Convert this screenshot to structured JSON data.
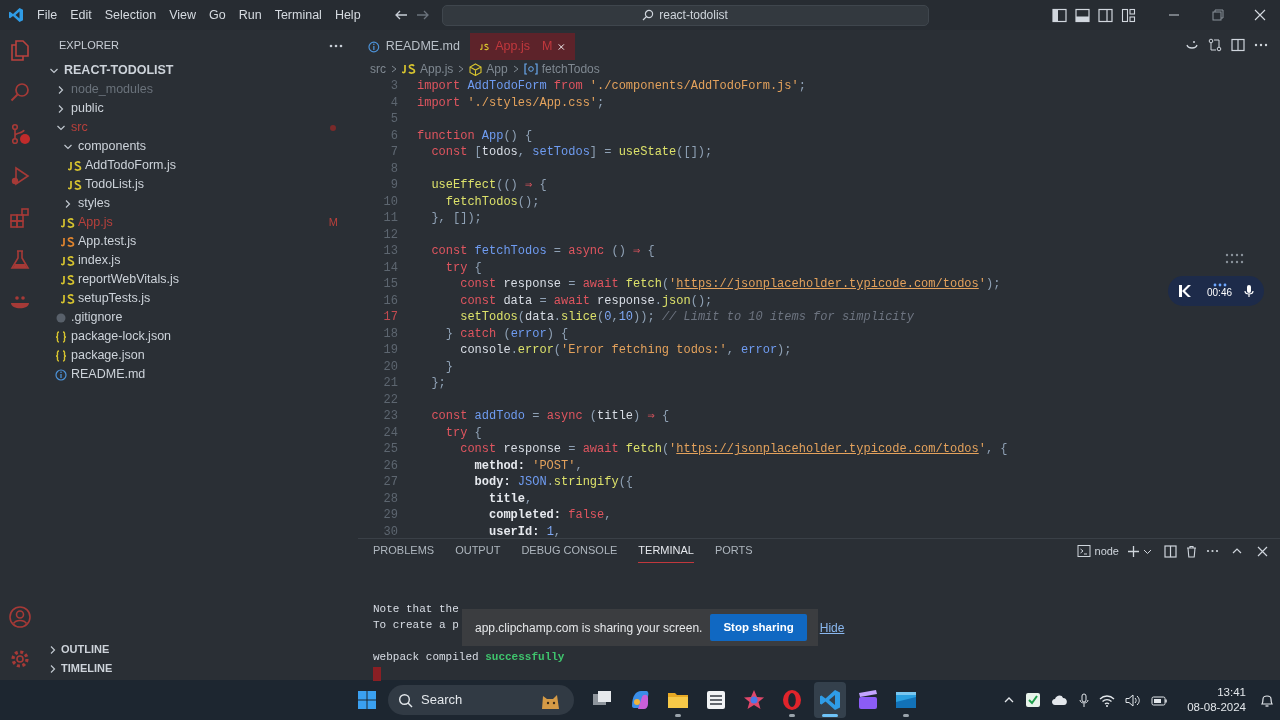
{
  "title_bar": {
    "menu": [
      "File",
      "Edit",
      "Selection",
      "View",
      "Go",
      "Run",
      "Terminal",
      "Help"
    ],
    "search": "react-todolist"
  },
  "sidebar": {
    "title": "EXPLORER",
    "tree": {
      "label": "REACT-TODOLIST",
      "kind": "root",
      "expanded": true,
      "modified": false,
      "ignored": false,
      "children": [
        {
          "label": "node_modules",
          "kind": "folder",
          "expanded": false,
          "modified": false,
          "ignored": true
        },
        {
          "label": "public",
          "kind": "folder",
          "expanded": false,
          "modified": false,
          "ignored": false
        },
        {
          "label": "src",
          "kind": "folder",
          "expanded": true,
          "modified": true,
          "ignored": false,
          "children": [
            {
              "label": "components",
              "kind": "folder",
              "expanded": true,
              "modified": false,
              "ignored": false,
              "children": [
                {
                  "label": "AddTodoForm.js",
                  "kind": "js",
                  "modified": false,
                  "ignored": false
                },
                {
                  "label": "TodoList.js",
                  "kind": "js",
                  "modified": false,
                  "ignored": false
                }
              ]
            },
            {
              "label": "styles",
              "kind": "folder",
              "expanded": false,
              "modified": false,
              "ignored": false
            },
            {
              "label": "App.js",
              "kind": "js",
              "modified": true,
              "ignored": false,
              "badge": "M"
            },
            {
              "label": "App.test.js",
              "kind": "test",
              "modified": false,
              "ignored": false
            },
            {
              "label": "index.js",
              "kind": "js",
              "modified": false,
              "ignored": false
            },
            {
              "label": "reportWebVitals.js",
              "kind": "js",
              "modified": false,
              "ignored": false
            },
            {
              "label": "setupTests.js",
              "kind": "js",
              "modified": false,
              "ignored": false
            }
          ]
        },
        {
          "label": ".gitignore",
          "kind": "config",
          "modified": false,
          "ignored": false
        },
        {
          "label": "package-lock.json",
          "kind": "json",
          "modified": false,
          "ignored": false
        },
        {
          "label": "package.json",
          "kind": "json",
          "modified": false,
          "ignored": false
        },
        {
          "label": "README.md",
          "kind": "info",
          "modified": false,
          "ignored": false
        }
      ]
    },
    "sections": [
      {
        "label": "OUTLINE",
        "expanded": false
      },
      {
        "label": "TIMELINE",
        "expanded": false
      }
    ]
  },
  "tabs": [
    {
      "label": "README.md",
      "kind": "info",
      "selected": false
    },
    {
      "label": "App.js",
      "kind": "js",
      "selected": true,
      "badge": "M"
    }
  ],
  "breadcrumbs": [
    {
      "label": "src",
      "kind": "folder"
    },
    {
      "label": "App.js",
      "kind": "js"
    },
    {
      "label": "App",
      "kind": "component"
    },
    {
      "label": "fetchTodos",
      "kind": "variable"
    }
  ],
  "editor": {
    "lines": [
      {
        "number": "3",
        "current": false,
        "tokens": [
          {
            "text": "import ",
            "kind": "kw"
          },
          {
            "text": "AddTodoForm",
            "kind": "id"
          },
          {
            "text": " from ",
            "kind": "kw"
          },
          {
            "text": "'./components/AddTodoForm.js'",
            "kind": "str"
          },
          {
            "text": ";",
            "kind": "p"
          }
        ]
      },
      {
        "number": "4",
        "current": false,
        "tokens": [
          {
            "text": "import ",
            "kind": "kw"
          },
          {
            "text": "'./styles/App.css'",
            "kind": "str"
          },
          {
            "text": ";",
            "kind": "p"
          }
        ]
      },
      {
        "number": "5",
        "current": false
      },
      {
        "number": "6",
        "current": false,
        "tokens": [
          {
            "text": "function ",
            "kind": "kw"
          },
          {
            "text": "App",
            "kind": "id"
          },
          {
            "text": "() {",
            "kind": "p"
          }
        ]
      },
      {
        "number": "7",
        "current": false,
        "tokens": [
          {
            "text": "  const ",
            "kind": "kw"
          },
          {
            "text": "[",
            "kind": "p"
          },
          {
            "text": "todos",
            "kind": "pl"
          },
          {
            "text": ", ",
            "kind": "p"
          },
          {
            "text": "setTodos",
            "kind": "id"
          },
          {
            "text": "] = ",
            "kind": "p"
          },
          {
            "text": "useState",
            "kind": "fn"
          },
          {
            "text": "([]);",
            "kind": "p"
          }
        ]
      },
      {
        "number": "8",
        "current": false
      },
      {
        "number": "9",
        "current": false,
        "tokens": [
          {
            "text": "  useEffect",
            "kind": "fn"
          },
          {
            "text": "(() ",
            "kind": "p"
          },
          {
            "text": "⇒",
            "kind": "kw"
          },
          {
            "text": " {",
            "kind": "p"
          }
        ]
      },
      {
        "number": "10",
        "current": false,
        "tokens": [
          {
            "text": "    fetchTodos",
            "kind": "fn"
          },
          {
            "text": "();",
            "kind": "p"
          }
        ]
      },
      {
        "number": "11",
        "current": false,
        "tokens": [
          {
            "text": "  }, []);",
            "kind": "p"
          }
        ]
      },
      {
        "number": "12",
        "current": false
      },
      {
        "number": "13",
        "current": false,
        "tokens": [
          {
            "text": "  const ",
            "kind": "kw"
          },
          {
            "text": "fetchTodos",
            "kind": "id"
          },
          {
            "text": " = ",
            "kind": "p"
          },
          {
            "text": "async ",
            "kind": "kw"
          },
          {
            "text": "() ",
            "kind": "p"
          },
          {
            "text": "⇒",
            "kind": "kw"
          },
          {
            "text": " {",
            "kind": "p"
          }
        ]
      },
      {
        "number": "14",
        "current": false,
        "tokens": [
          {
            "text": "    try ",
            "kind": "kw"
          },
          {
            "text": "{",
            "kind": "p"
          }
        ]
      },
      {
        "number": "15",
        "current": false,
        "tokens": [
          {
            "text": "      const ",
            "kind": "kw"
          },
          {
            "text": "response",
            "kind": "pl"
          },
          {
            "text": " = ",
            "kind": "p"
          },
          {
            "text": "await ",
            "kind": "kw"
          },
          {
            "text": "fetch",
            "kind": "fn"
          },
          {
            "text": "(",
            "kind": "p"
          },
          {
            "text": "'",
            "kind": "str"
          },
          {
            "text": "https://jsonplaceholder.typicode.com/todos",
            "kind": "url"
          },
          {
            "text": "'",
            "kind": "str"
          },
          {
            "text": ");",
            "kind": "p"
          }
        ]
      },
      {
        "number": "16",
        "current": false,
        "tokens": [
          {
            "text": "      const ",
            "kind": "kw"
          },
          {
            "text": "data",
            "kind": "pl"
          },
          {
            "text": " = ",
            "kind": "p"
          },
          {
            "text": "await ",
            "kind": "kw"
          },
          {
            "text": "response",
            "kind": "pl"
          },
          {
            "text": ".",
            "kind": "p"
          },
          {
            "text": "json",
            "kind": "fn"
          },
          {
            "text": "();",
            "kind": "p"
          }
        ]
      },
      {
        "number": "17",
        "current": true,
        "tokens": [
          {
            "text": "      setTodos",
            "kind": "fn"
          },
          {
            "text": "(",
            "kind": "p"
          },
          {
            "text": "data",
            "kind": "pl"
          },
          {
            "text": ".",
            "kind": "p"
          },
          {
            "text": "slice",
            "kind": "fn"
          },
          {
            "text": "(",
            "kind": "p"
          },
          {
            "text": "0",
            "kind": "num"
          },
          {
            "text": ",",
            "kind": "p"
          },
          {
            "text": "10",
            "kind": "num"
          },
          {
            "text": ")); ",
            "kind": "p"
          },
          {
            "text": "// Limit to 10 items for simplicity",
            "kind": "cm"
          }
        ]
      },
      {
        "number": "18",
        "current": false,
        "tokens": [
          {
            "text": "    } ",
            "kind": "p"
          },
          {
            "text": "catch ",
            "kind": "kw"
          },
          {
            "text": "(",
            "kind": "p"
          },
          {
            "text": "error",
            "kind": "id"
          },
          {
            "text": ") {",
            "kind": "p"
          }
        ]
      },
      {
        "number": "19",
        "current": false,
        "tokens": [
          {
            "text": "      console",
            "kind": "pl"
          },
          {
            "text": ".",
            "kind": "p"
          },
          {
            "text": "error",
            "kind": "fn"
          },
          {
            "text": "(",
            "kind": "p"
          },
          {
            "text": "'Error fetching todos:'",
            "kind": "str"
          },
          {
            "text": ", ",
            "kind": "p"
          },
          {
            "text": "error",
            "kind": "id"
          },
          {
            "text": ");",
            "kind": "p"
          }
        ]
      },
      {
        "number": "20",
        "current": false,
        "tokens": [
          {
            "text": "    }",
            "kind": "p"
          }
        ]
      },
      {
        "number": "21",
        "current": false,
        "tokens": [
          {
            "text": "  };",
            "kind": "p"
          }
        ]
      },
      {
        "number": "22",
        "current": false
      },
      {
        "number": "23",
        "current": false,
        "tokens": [
          {
            "text": "  const ",
            "kind": "kw"
          },
          {
            "text": "addTodo",
            "kind": "id"
          },
          {
            "text": " = ",
            "kind": "p"
          },
          {
            "text": "async ",
            "kind": "kw"
          },
          {
            "text": "(",
            "kind": "p"
          },
          {
            "text": "title",
            "kind": "pl"
          },
          {
            "text": ") ",
            "kind": "p"
          },
          {
            "text": "⇒",
            "kind": "kw"
          },
          {
            "text": " {",
            "kind": "p"
          }
        ]
      },
      {
        "number": "24",
        "current": false,
        "tokens": [
          {
            "text": "    try ",
            "kind": "kw"
          },
          {
            "text": "{",
            "kind": "p"
          }
        ]
      },
      {
        "number": "25",
        "current": false,
        "tokens": [
          {
            "text": "      const ",
            "kind": "kw"
          },
          {
            "text": "response",
            "kind": "pl"
          },
          {
            "text": " = ",
            "kind": "p"
          },
          {
            "text": "await ",
            "kind": "kw"
          },
          {
            "text": "fetch",
            "kind": "fn"
          },
          {
            "text": "(",
            "kind": "p"
          },
          {
            "text": "'",
            "kind": "str"
          },
          {
            "text": "https://jsonplaceholder.typicode.com/todos",
            "kind": "url"
          },
          {
            "text": "'",
            "kind": "str"
          },
          {
            "text": ", {",
            "kind": "p"
          }
        ]
      },
      {
        "number": "26",
        "current": false,
        "tokens": [
          {
            "text": "        method: ",
            "kind": "prop"
          },
          {
            "text": "'POST'",
            "kind": "str"
          },
          {
            "text": ",",
            "kind": "p"
          }
        ]
      },
      {
        "number": "27",
        "current": false,
        "tokens": [
          {
            "text": "        body: ",
            "kind": "prop"
          },
          {
            "text": "JSON",
            "kind": "id"
          },
          {
            "text": ".",
            "kind": "p"
          },
          {
            "text": "stringify",
            "kind": "fn"
          },
          {
            "text": "({",
            "kind": "p"
          }
        ]
      },
      {
        "number": "28",
        "current": false,
        "tokens": [
          {
            "text": "          title",
            "kind": "prop"
          },
          {
            "text": ",",
            "kind": "p"
          }
        ]
      },
      {
        "number": "29",
        "current": false,
        "tokens": [
          {
            "text": "          completed: ",
            "kind": "prop"
          },
          {
            "text": "false",
            "kind": "kw"
          },
          {
            "text": ",",
            "kind": "p"
          }
        ]
      },
      {
        "number": "30",
        "current": false,
        "tokens": [
          {
            "text": "          userId: ",
            "kind": "prop"
          },
          {
            "text": "1",
            "kind": "num"
          },
          {
            "text": ",",
            "kind": "p"
          }
        ]
      }
    ]
  },
  "recording_widget": {
    "time": "00:46"
  },
  "panel": {
    "tabs": [
      {
        "label": "PROBLEMS",
        "selected": false
      },
      {
        "label": "OUTPUT",
        "selected": false
      },
      {
        "label": "DEBUG CONSOLE",
        "selected": false
      },
      {
        "label": "TERMINAL",
        "selected": true
      },
      {
        "label": "PORTS",
        "selected": false
      }
    ],
    "terminal_name": "node",
    "terminal_lines": [
      {
        "tokens": [
          {
            "text": "Note that the",
            "kind": "pl"
          }
        ]
      },
      {
        "tokens": [
          {
            "text": "To create a p",
            "kind": "pl"
          }
        ]
      }
    ],
    "compile_message": {
      "tokens": [
        {
          "text": "webpack compiled ",
          "kind": "pl"
        },
        {
          "text": "successfully",
          "kind": "success"
        }
      ]
    }
  },
  "share_bar": {
    "message": "app.clipchamp.com is sharing your screen.",
    "stop": "Stop sharing",
    "hide": "Hide"
  },
  "taskbar": {
    "search": "Search",
    "time": "13:41",
    "date": "08-08-2024",
    "apps": [
      {
        "kind": "taskview",
        "running": false,
        "active": false
      },
      {
        "kind": "copilot",
        "running": false,
        "active": false
      },
      {
        "kind": "folder",
        "running": true,
        "active": false
      },
      {
        "kind": "notes",
        "running": false,
        "active": false
      },
      {
        "kind": "star",
        "running": false,
        "active": false
      },
      {
        "kind": "opera",
        "running": true,
        "active": false
      },
      {
        "kind": "code",
        "running": true,
        "active": true
      },
      {
        "kind": "clapper",
        "running": false,
        "active": false
      },
      {
        "kind": "window",
        "running": true,
        "active": false
      }
    ]
  }
}
